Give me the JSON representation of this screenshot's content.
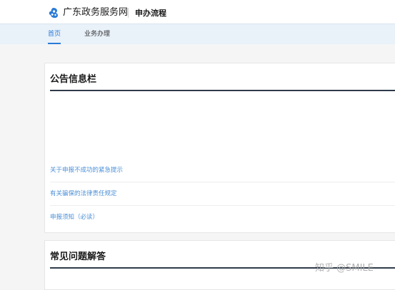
{
  "header": {
    "site_name": "广东政务服务网",
    "page_heading": "申办流程"
  },
  "nav": {
    "items": [
      {
        "label": "首页",
        "active": true
      },
      {
        "label": "业务办理",
        "active": false
      }
    ]
  },
  "notice_panel": {
    "title": "公告信息栏",
    "items": [
      {
        "label": "关于申报不成功的紧急提示"
      },
      {
        "label": "有关骗保的法律责任规定"
      },
      {
        "label": "申报须知（必读）"
      }
    ]
  },
  "faq_panel": {
    "title": "常见问题解答"
  },
  "watermark": "知乎 @SMILE",
  "colors": {
    "accent": "#2a7bd6",
    "nav_bg": "#e9f1f9",
    "link": "#4b8fd6",
    "rule": "#2f3b4a"
  },
  "icons": {
    "logo": "guangdong-gov-logo-icon"
  }
}
